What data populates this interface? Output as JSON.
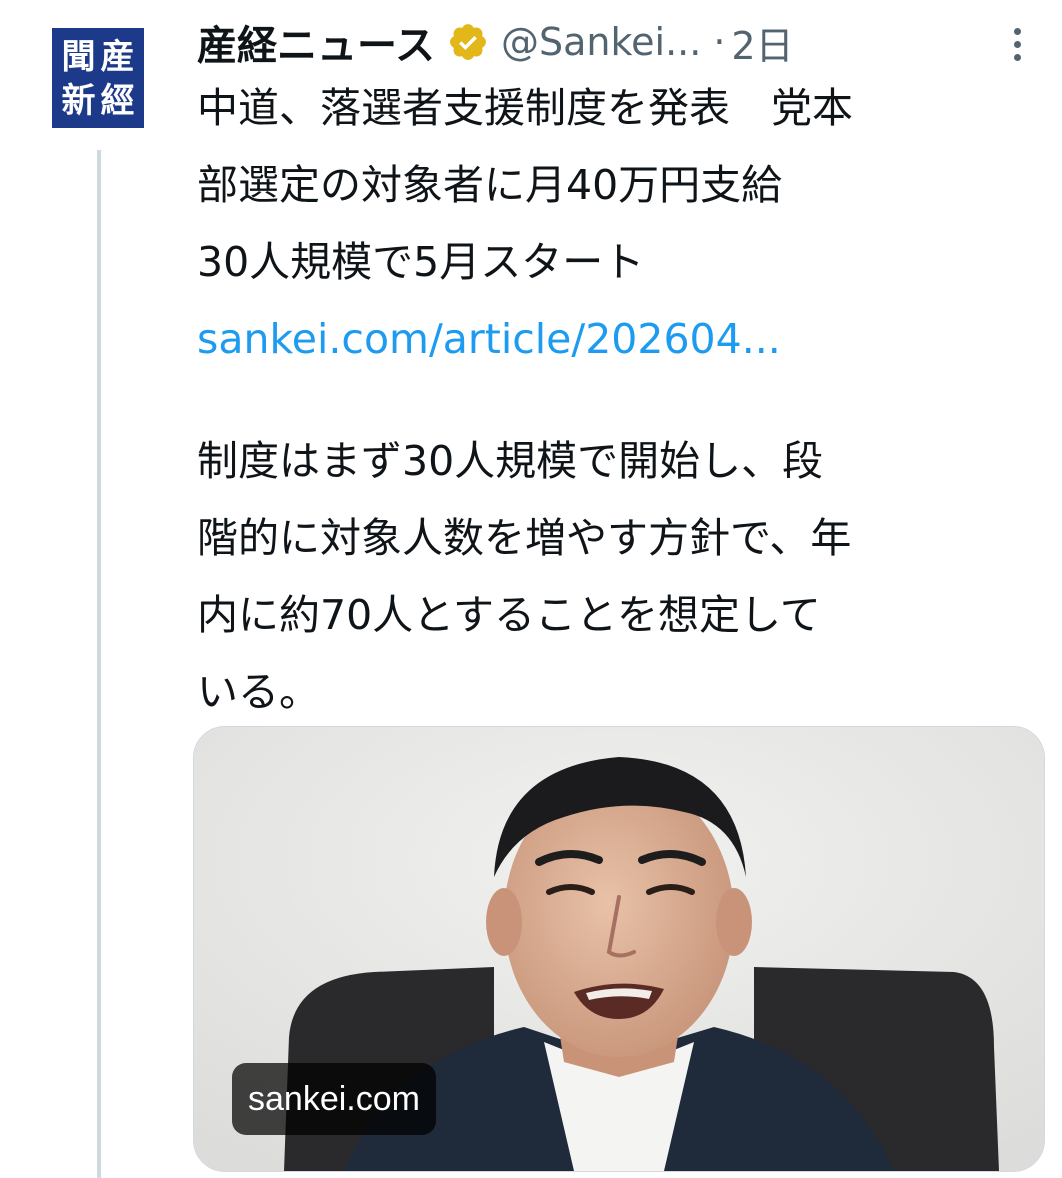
{
  "account": {
    "avatar_chars": [
      "産",
      "經",
      "新",
      "聞"
    ],
    "display_name": "産経ニュース",
    "handle": "@Sankei...",
    "separator": "·",
    "time": "2日"
  },
  "tweet": {
    "lines": [
      "中道、落選者支援制度を発表　党本",
      "部選定の対象者に月40万円支給",
      "30人規模で5月スタート"
    ],
    "link": "sankei.com/article/202604...",
    "paragraph_lines": [
      "制度はまず30人規模で開始し、段",
      "階的に対象人数を増やす方針で、年",
      "内に約70人とすることを想定して",
      "いる。"
    ]
  },
  "card": {
    "domain": "sankei.com"
  },
  "icons": {
    "verified": "verified-badge-icon",
    "more": "more-options-icon"
  },
  "colors": {
    "link": "#1d9bf0",
    "secondary_text": "#536471",
    "verified_gold": "#e2b719",
    "avatar_blue": "#1d3a8a"
  }
}
